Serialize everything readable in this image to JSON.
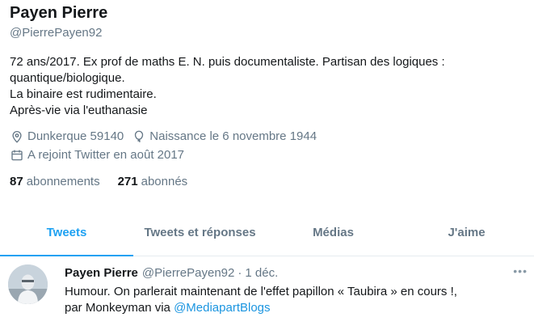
{
  "profile": {
    "name": "Payen Pierre",
    "handle": "@PierrePayen92",
    "bio_lines": [
      "72 ans/2017. Ex prof de maths E. N. puis documentaliste. Partisan des logiques :",
      "quantique/biologique.",
      "La binaire est rudimentaire.",
      "Après-vie via l'euthanasie"
    ],
    "location": "Dunkerque 59140",
    "birth": "Naissance le 6 novembre 1944",
    "joined": "A rejoint Twitter en août 2017",
    "following_count": "87",
    "following_label": "abonnements",
    "followers_count": "271",
    "followers_label": "abonnés",
    "icons": [
      "location-pin-icon",
      "balloon-icon",
      "calendar-icon"
    ]
  },
  "tabs": [
    {
      "label": "Tweets",
      "active": true
    },
    {
      "label": "Tweets et réponses",
      "active": false
    },
    {
      "label": "Médias",
      "active": false
    },
    {
      "label": "J'aime",
      "active": false
    }
  ],
  "tweet": {
    "author_name": "Payen Pierre",
    "author_handle": "@PierrePayen92",
    "separator": "·",
    "time": "1 déc.",
    "text_line1": "Humour. On parlerait maintenant de l'effet papillon « Taubira » en cours !,",
    "text_line2_prefix": "par Monkeyman via ",
    "text_link": "@MediapartBlogs",
    "menu": "•••"
  },
  "colors": {
    "accent": "#1da1f2",
    "link": "#1b95e0",
    "muted": "#657786",
    "divider": "#e6ecf0"
  }
}
